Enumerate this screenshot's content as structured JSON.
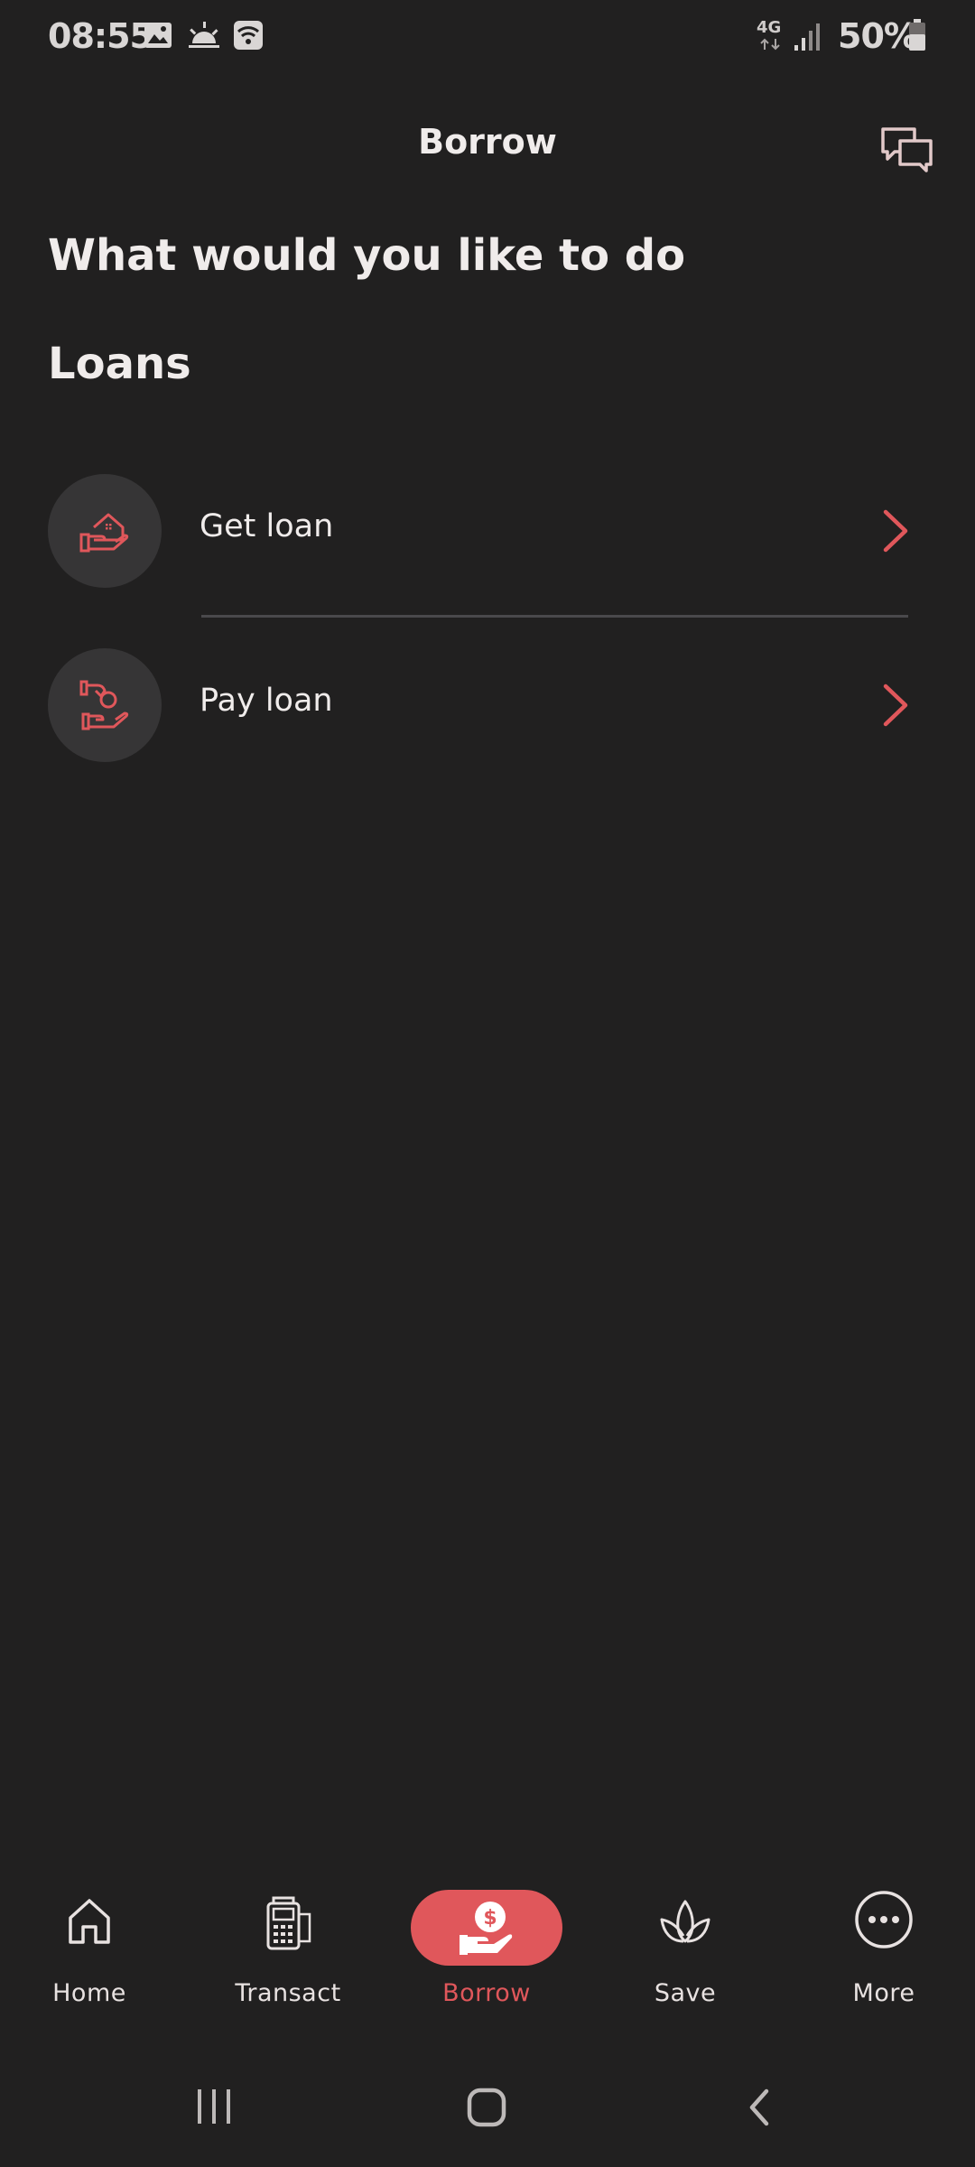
{
  "status_bar": {
    "time": "08:55",
    "network": "4G",
    "battery": "50%"
  },
  "header": {
    "title": "Borrow"
  },
  "main": {
    "title": "What would you like to do",
    "section_title": "Loans",
    "items": [
      {
        "label": "Get loan",
        "icon": "house-in-hand-icon"
      },
      {
        "label": "Pay loan",
        "icon": "coin-hand-to-hand-icon"
      }
    ]
  },
  "bottom_nav": {
    "items": [
      {
        "label": "Home",
        "icon": "home-icon"
      },
      {
        "label": "Transact",
        "icon": "pos-terminal-icon"
      },
      {
        "label": "Borrow",
        "icon": "dollar-hand-icon"
      },
      {
        "label": "Save",
        "icon": "leaf-icon"
      },
      {
        "label": "More",
        "icon": "more-dots-icon"
      }
    ],
    "active": "Borrow"
  },
  "colors": {
    "background": "#212020",
    "accent": "#e0575b",
    "text": "#f0eceb",
    "icon_circle": "#363536"
  }
}
